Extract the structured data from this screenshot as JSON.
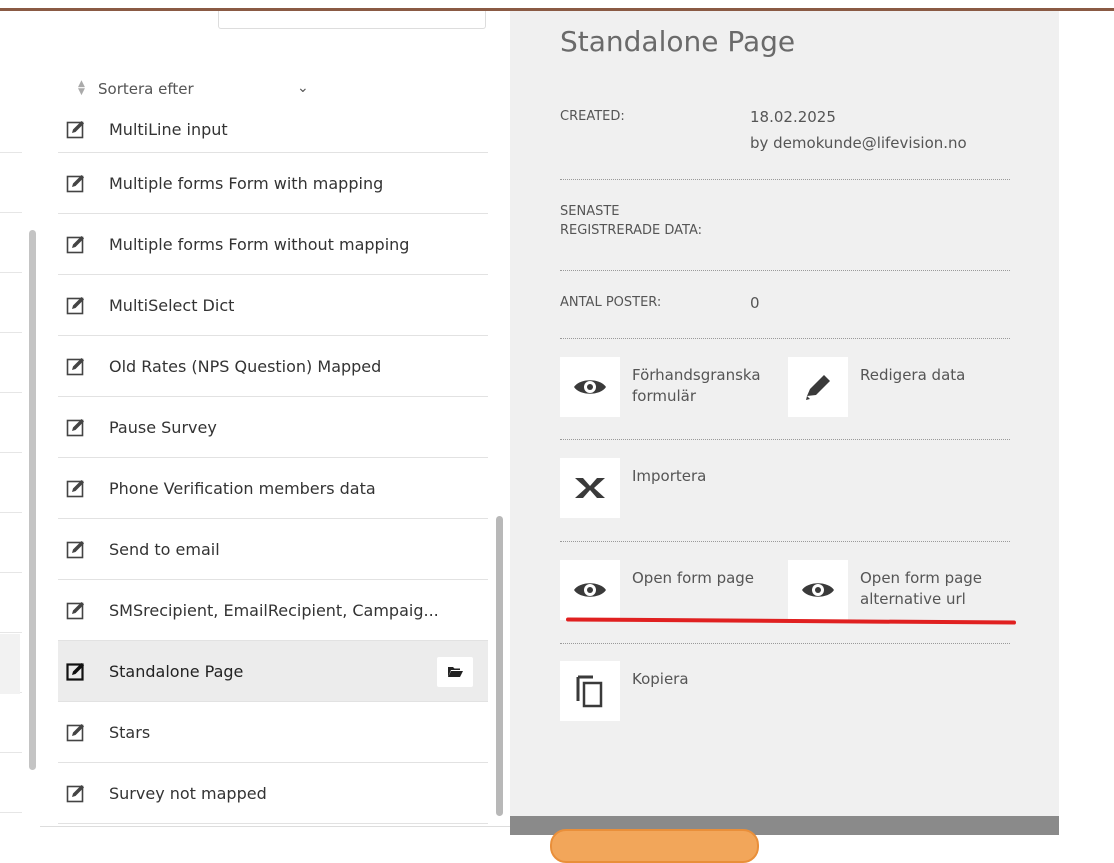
{
  "list": {
    "sort_label": "Sortera efter",
    "items": [
      {
        "label": "MultiLine input",
        "selected": false
      },
      {
        "label": "Multiple forms Form with mapping",
        "selected": false
      },
      {
        "label": "Multiple forms Form without mapping",
        "selected": false
      },
      {
        "label": "MultiSelect Dict",
        "selected": false
      },
      {
        "label": "Old Rates (NPS Question) Mapped",
        "selected": false
      },
      {
        "label": "Pause Survey",
        "selected": false
      },
      {
        "label": "Phone Verification members data",
        "selected": false
      },
      {
        "label": "Send to email",
        "selected": false
      },
      {
        "label": "SMSrecipient, EmailRecipient, Campaig...",
        "selected": false
      },
      {
        "label": "Standalone Page",
        "selected": true
      },
      {
        "label": "Stars",
        "selected": false
      },
      {
        "label": "Survey not mapped",
        "selected": false
      }
    ]
  },
  "detail": {
    "title": "Standalone Page",
    "created_label": "CREATED:",
    "created_date": "18.02.2025",
    "created_by": "by demokunde@lifevision.no",
    "last_registered_label_1": "SENASTE",
    "last_registered_label_2": "REGISTRERADE DATA:",
    "count_label": "ANTAL POSTER:",
    "count_value": "0",
    "actions": {
      "preview_1": "Förhandsgranska",
      "preview_2": "formulär",
      "edit_data": "Redigera data",
      "import": "Importera",
      "open_form_page": "Open form page",
      "open_form_alt_1": "Open form page",
      "open_form_alt_2": "alternative url",
      "copy": "Kopiera"
    }
  },
  "colors": {
    "accent_top": "#8a5a44",
    "annotation_red": "#e02020",
    "footer_button": "#f2a65a"
  }
}
